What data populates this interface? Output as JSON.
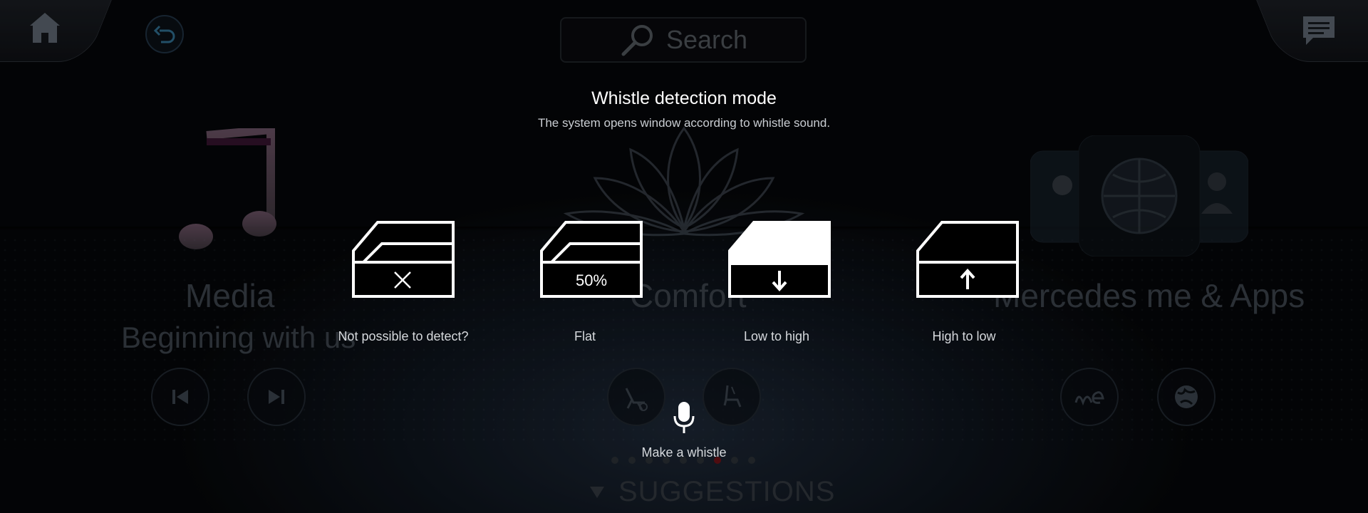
{
  "search": {
    "label": "Search"
  },
  "background": {
    "media": {
      "title": "Media",
      "subtitle": "Beginning with us"
    },
    "comfort": {
      "title": "Comfort"
    },
    "apps": {
      "title": "Mercedes me & Apps"
    },
    "suggestions_label": "SUGGESTIONS",
    "page_indicator": {
      "count": 9,
      "active_index": 6
    }
  },
  "dialog": {
    "title": "Whistle detection mode",
    "subtitle": "The system opens window according to whistle sound.",
    "options": [
      {
        "label": "Not possible to detect?",
        "icon": "window-cross-icon"
      },
      {
        "label": "Flat",
        "icon": "window-percent-icon",
        "value_text": "50%"
      },
      {
        "label": "Low to high",
        "icon": "window-down-arrow-icon"
      },
      {
        "label": "High to low",
        "icon": "window-up-arrow-icon"
      }
    ],
    "mic_label": "Make a whistle"
  },
  "colors": {
    "background": "#05070a",
    "foreground": "#ffffff",
    "dim_text": "#3a4048",
    "active_dot": "#6a1016"
  }
}
